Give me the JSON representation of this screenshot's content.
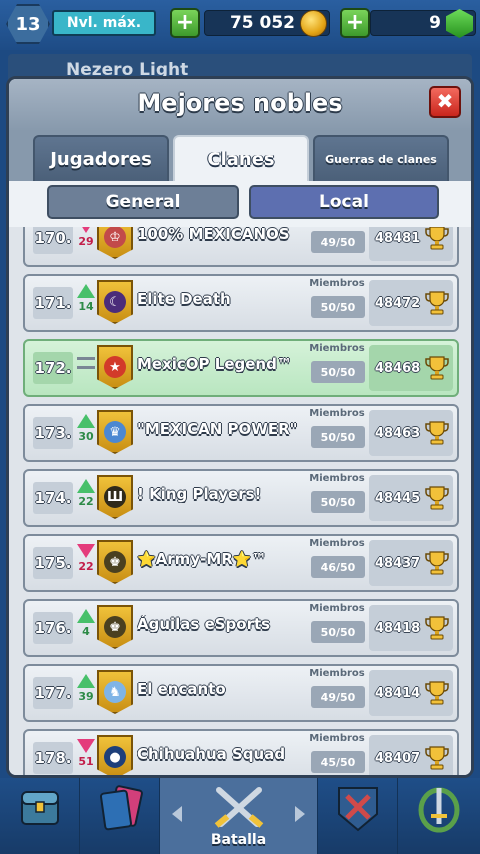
{
  "topbar": {
    "level": "13",
    "level_label": "Nvl. máx.",
    "gold": "75 052",
    "gems": "9"
  },
  "background_clan": {
    "name": "Nezero Light"
  },
  "modal": {
    "title": "Mejores nobles",
    "tabs": [
      {
        "label": "Jugadores",
        "active": false
      },
      {
        "label": "Clanes",
        "active": true
      },
      {
        "label": "Guerras de clanes",
        "active": false
      }
    ],
    "subtabs": [
      {
        "label": "General",
        "active": false
      },
      {
        "label": "Local",
        "active": true
      }
    ],
    "members_header": "Miembros",
    "rows": [
      {
        "rank": "170.",
        "change": "down",
        "change_val": "29",
        "name": "100% MEXICANOS",
        "members": "49/50",
        "trophies": "48481",
        "badge_color": "#f0c23a",
        "badge_inner": "#c24a4a",
        "badge_glyph": "♔",
        "highlight": false
      },
      {
        "rank": "171.",
        "change": "up",
        "change_val": "14",
        "name": "Elite Death",
        "members": "50/50",
        "trophies": "48472",
        "badge_color": "#f0c23a",
        "badge_inner": "#4b2c7a",
        "badge_glyph": "☾",
        "highlight": false
      },
      {
        "rank": "172.",
        "change": "same",
        "change_val": "",
        "name": "MexicOP Legend™",
        "members": "50/50",
        "trophies": "48468",
        "badge_color": "#f0c23a",
        "badge_inner": "#d23a2a",
        "badge_glyph": "★",
        "highlight": true
      },
      {
        "rank": "173.",
        "change": "up",
        "change_val": "30",
        "name": "\"MEXICAN POWER\"",
        "members": "50/50",
        "trophies": "48463",
        "badge_color": "#f0c23a",
        "badge_inner": "#4c88d2",
        "badge_glyph": "♛",
        "highlight": false
      },
      {
        "rank": "174.",
        "change": "up",
        "change_val": "22",
        "name": "! King Players!",
        "members": "50/50",
        "trophies": "48445",
        "badge_color": "#f0c23a",
        "badge_inner": "#2f2a1a",
        "badge_glyph": "Ш",
        "highlight": false
      },
      {
        "rank": "175.",
        "change": "down",
        "change_val": "22",
        "name": "⭐Army-MR⭐™",
        "members": "46/50",
        "trophies": "48437",
        "badge_color": "#f0c23a",
        "badge_inner": "#4a4020",
        "badge_glyph": "♚",
        "highlight": false
      },
      {
        "rank": "176.",
        "change": "up",
        "change_val": "4",
        "name": "Águilas eSports",
        "members": "50/50",
        "trophies": "48418",
        "badge_color": "#f0c23a",
        "badge_inner": "#4a4020",
        "badge_glyph": "♚",
        "highlight": false
      },
      {
        "rank": "177.",
        "change": "up",
        "change_val": "39",
        "name": "El encanto",
        "members": "49/50",
        "trophies": "48414",
        "badge_color": "#f0c23a",
        "badge_inner": "#7fb4e6",
        "badge_glyph": "♞",
        "highlight": false
      },
      {
        "rank": "178.",
        "change": "down",
        "change_val": "51",
        "name": "Chihuahua Squad",
        "members": "45/50",
        "trophies": "48407",
        "badge_color": "#f0c23a",
        "badge_inner": "#1e3f7a",
        "badge_glyph": "●",
        "highlight": false
      }
    ]
  },
  "bottomnav": {
    "active_label": "Batalla"
  },
  "colors": {
    "accent_blue": "#1e4c86",
    "highlight_green": "#b9e6c0",
    "close_red": "#c9251c",
    "subtab_active": "#5d6fb0",
    "subtab_inactive": "#6d7f97"
  }
}
